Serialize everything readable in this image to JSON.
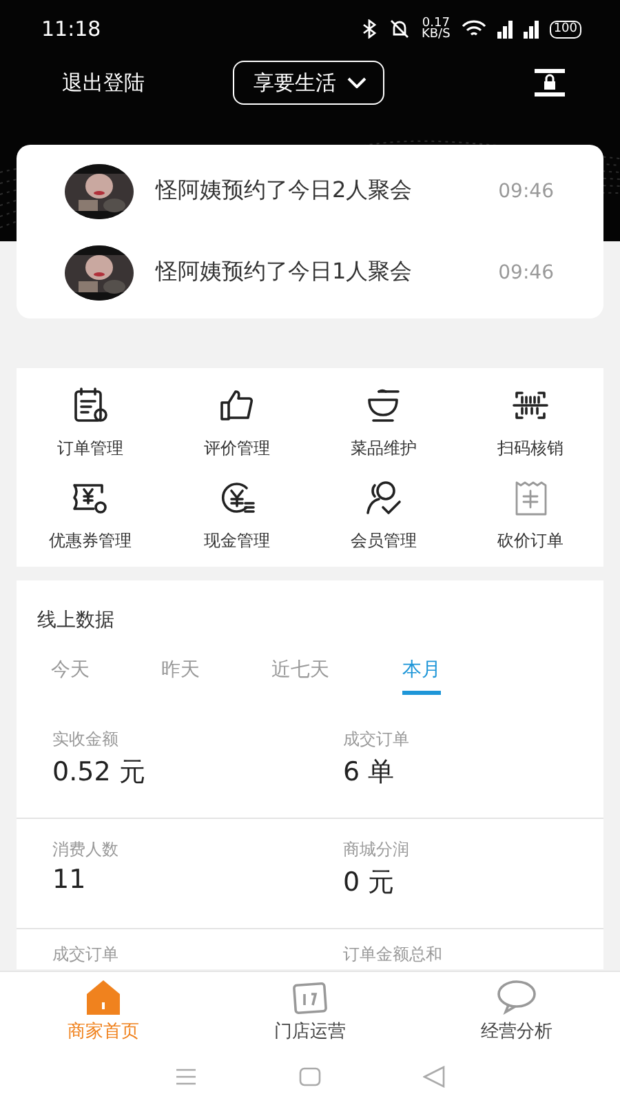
{
  "status_bar": {
    "time": "11:18",
    "speed": "0.17",
    "speed_unit": "KB/S",
    "battery": "100"
  },
  "header": {
    "logout": "退出登陆",
    "store_selector": "享要生活"
  },
  "notifications": [
    {
      "text": "怪阿姨预约了今日2人聚会",
      "time": "09:46"
    },
    {
      "text": "怪阿姨预约了今日1人聚会",
      "time": "09:46"
    }
  ],
  "functions": [
    {
      "kind": "order",
      "label": "订单管理"
    },
    {
      "kind": "review",
      "label": "评价管理"
    },
    {
      "kind": "dish",
      "label": "菜品维护"
    },
    {
      "kind": "scan",
      "label": "扫码核销"
    },
    {
      "kind": "coupon",
      "label": "优惠券管理"
    },
    {
      "kind": "cash",
      "label": "现金管理"
    },
    {
      "kind": "member",
      "label": "会员管理"
    },
    {
      "kind": "voucher",
      "label": "砍价订单"
    }
  ],
  "online_data": {
    "title": "线上数据",
    "tabs": [
      {
        "label": "今天",
        "selected": false
      },
      {
        "label": "昨天",
        "selected": false
      },
      {
        "label": "近七天",
        "selected": false
      },
      {
        "label": "本月",
        "selected": true
      }
    ],
    "stat_rows": [
      [
        {
          "label": "实收金额",
          "value": "0.52 元"
        },
        {
          "label": "成交订单",
          "value": "6 单"
        }
      ],
      [
        {
          "label": "消费人数",
          "value": "11"
        },
        {
          "label": "商城分润",
          "value": "0 元"
        }
      ],
      [
        {
          "label": "成交订单"
        },
        {
          "label": "订单金额总和"
        }
      ]
    ]
  },
  "bottom_tabs": [
    {
      "kind": "home",
      "label": "商家首页",
      "selected": true
    },
    {
      "kind": "calendar",
      "label": "门店运营",
      "selected": false
    },
    {
      "kind": "chat",
      "label": "经营分析",
      "selected": false
    }
  ]
}
